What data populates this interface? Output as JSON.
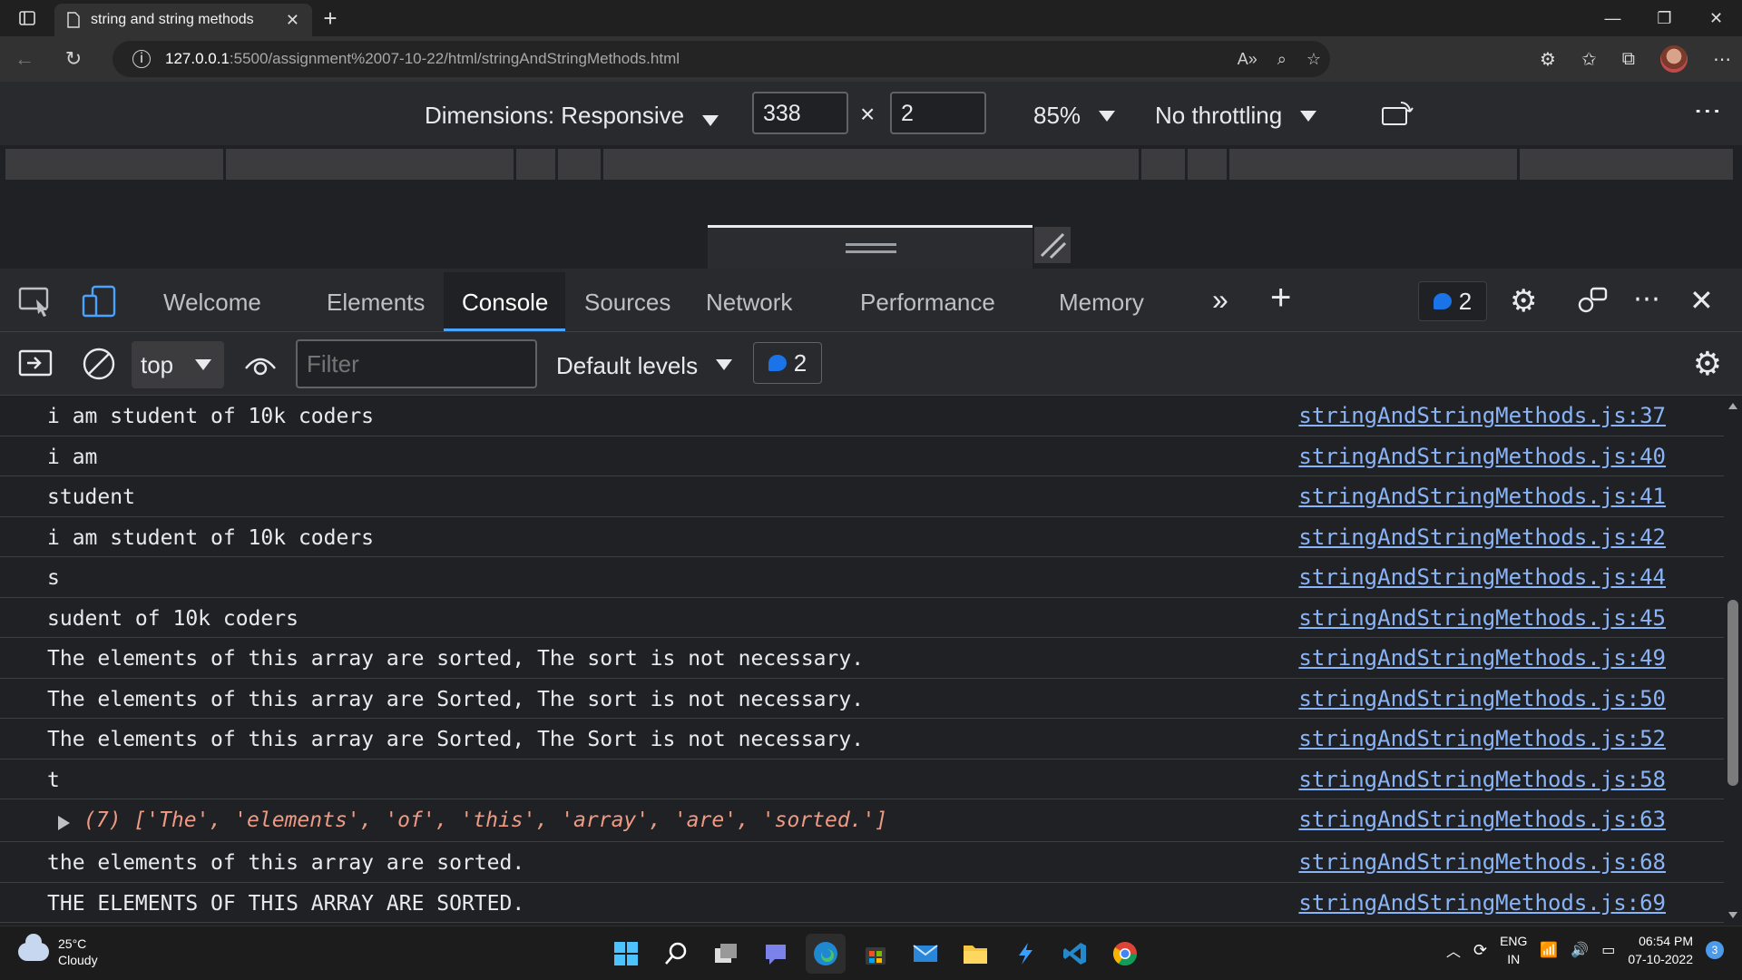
{
  "browser": {
    "tab_title": "string and string methods",
    "url_host": "127.0.0.1",
    "url_path": ":5500/assignment%2007-10-22/html/stringAndStringMethods.html"
  },
  "device_toolbar": {
    "dimensions_label": "Dimensions: Responsive",
    "width_value": "338",
    "height_value": "2",
    "times": "×",
    "zoom": "85%",
    "throttling": "No throttling",
    "more": "⋮"
  },
  "devtools": {
    "tabs": [
      {
        "label": "Welcome"
      },
      {
        "label": "Elements"
      },
      {
        "label": "Console"
      },
      {
        "label": "Sources"
      },
      {
        "label": "Network"
      },
      {
        "label": "Performance"
      },
      {
        "label": "Memory"
      }
    ],
    "issues_count": "2"
  },
  "console_toolbar": {
    "context": "top",
    "filter_placeholder": "Filter",
    "levels": "Default levels",
    "issues_count": "2"
  },
  "console": {
    "messages": [
      {
        "text": "i am student of 10k coders",
        "source": "stringAndStringMethods.js:37"
      },
      {
        "text": "i am",
        "source": "stringAndStringMethods.js:40"
      },
      {
        "text": "student",
        "source": "stringAndStringMethods.js:41"
      },
      {
        "text": "i am student of 10k coders",
        "source": "stringAndStringMethods.js:42"
      },
      {
        "text": "s",
        "source": "stringAndStringMethods.js:44"
      },
      {
        "text": "sudent of 10k coders",
        "source": "stringAndStringMethods.js:45"
      },
      {
        "text": "The elements of this array are sorted, The sort is not necessary.",
        "source": "stringAndStringMethods.js:49"
      },
      {
        "text": "The elements of this array are Sorted, The sort is not necessary.",
        "source": "stringAndStringMethods.js:50"
      },
      {
        "text": "The elements of this array are Sorted, The Sort is not necessary.",
        "source": "stringAndStringMethods.js:52"
      },
      {
        "text": "t",
        "source": "stringAndStringMethods.js:58"
      },
      {
        "array_preview": "(7) ['The', 'elements', 'of', 'this', 'array', 'are', 'sorted.']",
        "source": "stringAndStringMethods.js:63"
      },
      {
        "text": "the elements of this array are sorted.",
        "source": "stringAndStringMethods.js:68"
      },
      {
        "text": "THE ELEMENTS OF THIS ARRAY ARE SORTED.",
        "source": "stringAndStringMethods.js:69"
      }
    ]
  },
  "taskbar": {
    "temperature": "25°C",
    "weather": "Cloudy",
    "lang": "ENG",
    "region": "IN",
    "time": "06:54 PM",
    "date": "07-10-2022",
    "notifications": "3"
  },
  "colors": {
    "accent": "#4aa3ff",
    "link": "#8ab4f8",
    "array_string": "#ee9a84",
    "panel_bg": "#202124"
  }
}
